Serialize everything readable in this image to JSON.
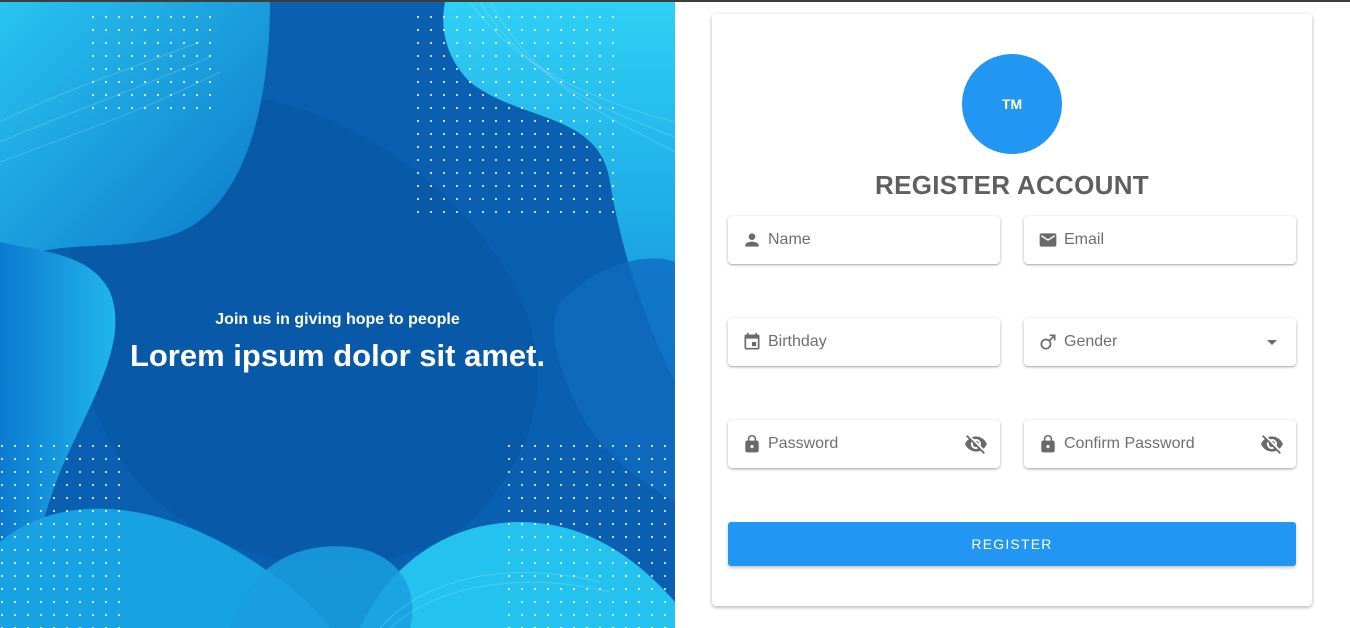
{
  "hero": {
    "subtitle": "Join us in giving hope to people",
    "headline": "Lorem ipsum dolor sit amet."
  },
  "form": {
    "logo_text": "TM",
    "title": "REGISTER ACCOUNT",
    "fields": {
      "name": {
        "placeholder": "Name",
        "icon": "person-icon"
      },
      "email": {
        "placeholder": "Email",
        "icon": "mail-icon"
      },
      "birthday": {
        "placeholder": "Birthday",
        "icon": "calendar-icon"
      },
      "gender": {
        "placeholder": "Gender",
        "icon": "male-icon",
        "trailing_icon": "dropdown-arrow-icon"
      },
      "password": {
        "placeholder": "Password",
        "icon": "lock-icon",
        "trailing_icon": "visibility-off-icon"
      },
      "confirm_password": {
        "placeholder": "Confirm Password",
        "icon": "lock-icon",
        "trailing_icon": "visibility-off-icon"
      }
    },
    "submit_label": "REGISTER"
  },
  "colors": {
    "accent": "#2196f3",
    "title_text": "#5f5f5f",
    "hero_deep": "#0a5fb0",
    "hero_light": "#1ec8f0"
  }
}
